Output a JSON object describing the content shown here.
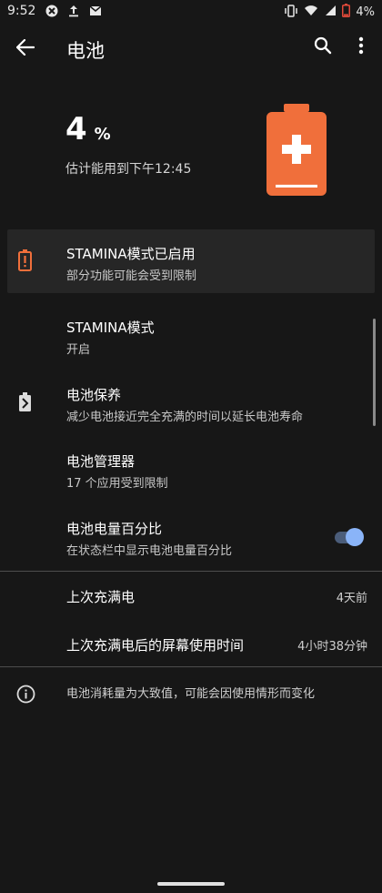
{
  "status_bar": {
    "time": "9:52",
    "battery_text": "4%"
  },
  "app_bar": {
    "title": "电池"
  },
  "battery_summary": {
    "percent": "4",
    "percent_unit": "%",
    "estimate": "估计能用到下午12:45",
    "level": 0.04
  },
  "stamina_banner": {
    "title": "STAMINA模式已启用",
    "subtitle": "部分功能可能会受到限制"
  },
  "settings": [
    {
      "title": "STAMINA模式",
      "subtitle": "开启"
    },
    {
      "title": "电池保养",
      "subtitle": "减少电池接近完全充满的时间以延长电池寿命"
    },
    {
      "title": "电池管理器",
      "subtitle": "17 个应用受到限制"
    },
    {
      "title": "电池电量百分比",
      "subtitle": "在状态栏中显示电池电量百分比",
      "toggle_on": true
    }
  ],
  "usage_rows": [
    {
      "label": "上次充满电",
      "value": "4天前"
    },
    {
      "label": "上次充满电后的屏幕使用时间",
      "value": "4小时38分钟"
    }
  ],
  "footer": {
    "note": "电池消耗量为大致值，可能会因使用情形而变化"
  },
  "colors": {
    "background": "#171717",
    "accent_orange": "#f06f3b",
    "toggle_thumb": "#8ab4f8",
    "toggle_track": "#4b5d7a"
  },
  "icons": {
    "back": "arrow-left-icon",
    "search": "search-icon",
    "more": "more-vertical-icon",
    "hero_battery": "battery-charge-icon",
    "stamina": "battery-alert-icon",
    "battery_care": "battery-care-icon",
    "info": "info-icon"
  }
}
